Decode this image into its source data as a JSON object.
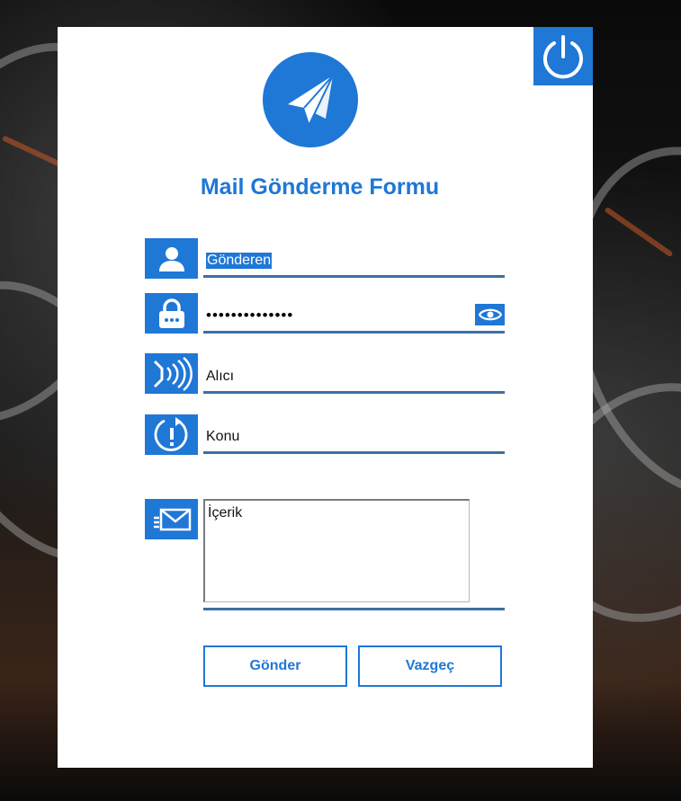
{
  "form": {
    "title": "Mail Gönderme Formu",
    "sender": {
      "value": "Gönderen",
      "selected": true
    },
    "password": {
      "masked_value": "••••••••••••••"
    },
    "recipient": {
      "value": "Alıcı"
    },
    "subject": {
      "value": "Konu"
    },
    "content": {
      "value": "İçerik"
    }
  },
  "buttons": {
    "send_label": "Gönder",
    "cancel_label": "Vazgeç"
  },
  "icons": {
    "power": "power-icon",
    "logo": "paper-plane-icon",
    "sender": "user-icon",
    "password": "lock-icon",
    "recipient": "signal-icon",
    "subject": "alert-icon",
    "content": "mail-icon",
    "show_password": "eye-icon"
  },
  "colors": {
    "accent": "#1f77d6",
    "underline": "#3c6fa3",
    "panel": "#ffffff"
  }
}
